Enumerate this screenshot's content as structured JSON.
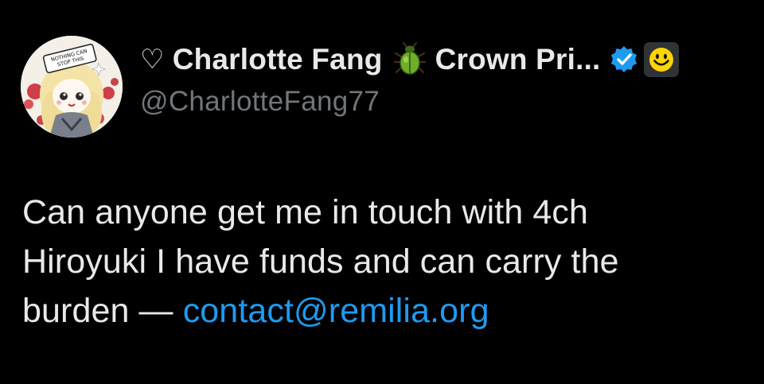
{
  "tweet": {
    "author": {
      "heart_symbol": "♡",
      "name_part1": "Charlotte Fang",
      "emoji_icon": "beetle-icon",
      "name_part2": "Crown Pri...",
      "verified_icon": "verified-badge-icon",
      "affiliate_icon": "smiley-face-icon",
      "handle": "@CharlotteFang77",
      "avatar": {
        "sign_text_line1": "NOTHING CAN",
        "sign_text_line2": "STOP THIS"
      }
    },
    "body": {
      "line1": "Can anyone get me in touch with 4ch",
      "line2": "Hiroyuki I have funds and can carry the",
      "line3_prefix": "burden — ",
      "link_text": "contact@remilia.org"
    }
  },
  "colors": {
    "background": "#000000",
    "primary_text": "#e7e9ea",
    "secondary_text": "#71767b",
    "link": "#1d9bf0",
    "verified": "#1d9bf0",
    "affiliate_face": "#ffd400"
  }
}
